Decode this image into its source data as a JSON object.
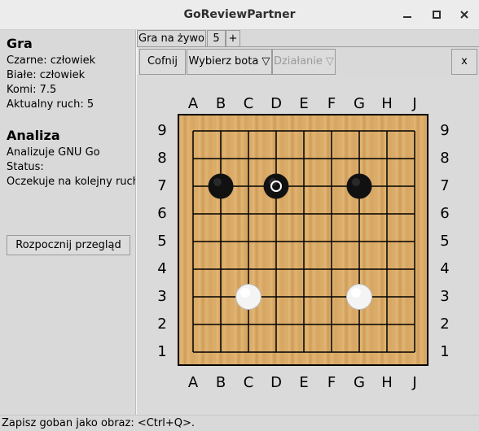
{
  "window": {
    "title": "GoReviewPartner"
  },
  "game": {
    "heading": "Gra",
    "black": "Czarne: człowiek",
    "white": "Białe: człowiek",
    "komi": "Komi: 7.5",
    "current_move": "Aktualny ruch: 5"
  },
  "analysis": {
    "heading": "Analiza",
    "engine": "Analizuje GNU Go",
    "status_label": "Status:",
    "status_value": "Oczekuje na kolejny ruch"
  },
  "start_review_button": "Rozpocznij przegląd",
  "tabs": [
    {
      "label": "Gra na żywo"
    },
    {
      "label": "5"
    },
    {
      "label": "+"
    }
  ],
  "toolbar": {
    "undo": "Cofnij",
    "select_bot": "Wybierz bota ▽",
    "action": "Działanie ▽",
    "close": "x"
  },
  "board": {
    "size": 9,
    "columns": [
      "A",
      "B",
      "C",
      "D",
      "E",
      "F",
      "G",
      "H",
      "J"
    ],
    "rows": [
      "9",
      "8",
      "7",
      "6",
      "5",
      "4",
      "3",
      "2",
      "1"
    ],
    "stones": [
      {
        "color": "black",
        "point": "B7"
      },
      {
        "color": "black",
        "point": "D7",
        "last_move": true
      },
      {
        "color": "black",
        "point": "G7"
      },
      {
        "color": "white",
        "point": "C3"
      },
      {
        "color": "white",
        "point": "G3"
      }
    ]
  },
  "statusbar": {
    "text": "Zapisz goban jako obraz: <Ctrl+Q>."
  }
}
